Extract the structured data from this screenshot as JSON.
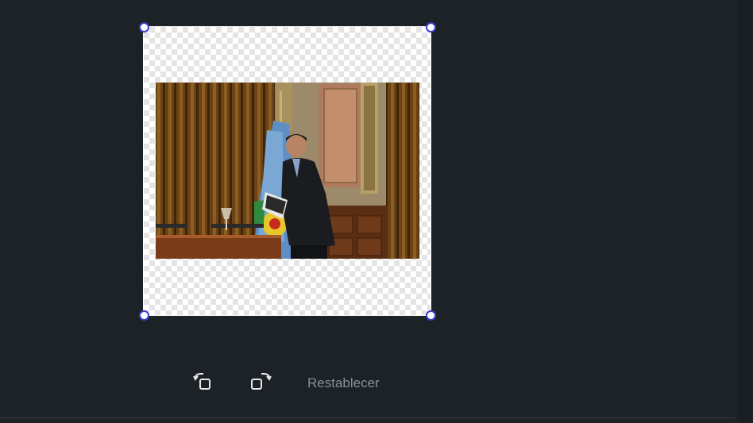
{
  "editor": {
    "toolbar": {
      "rotate_left_icon": "rotate-left-icon",
      "rotate_right_icon": "rotate-right-icon",
      "reset_label": "Restablecer"
    },
    "colors": {
      "background": "#1d2227",
      "handle_border": "#3a3fd0",
      "reset_text": "#8a9097"
    }
  }
}
